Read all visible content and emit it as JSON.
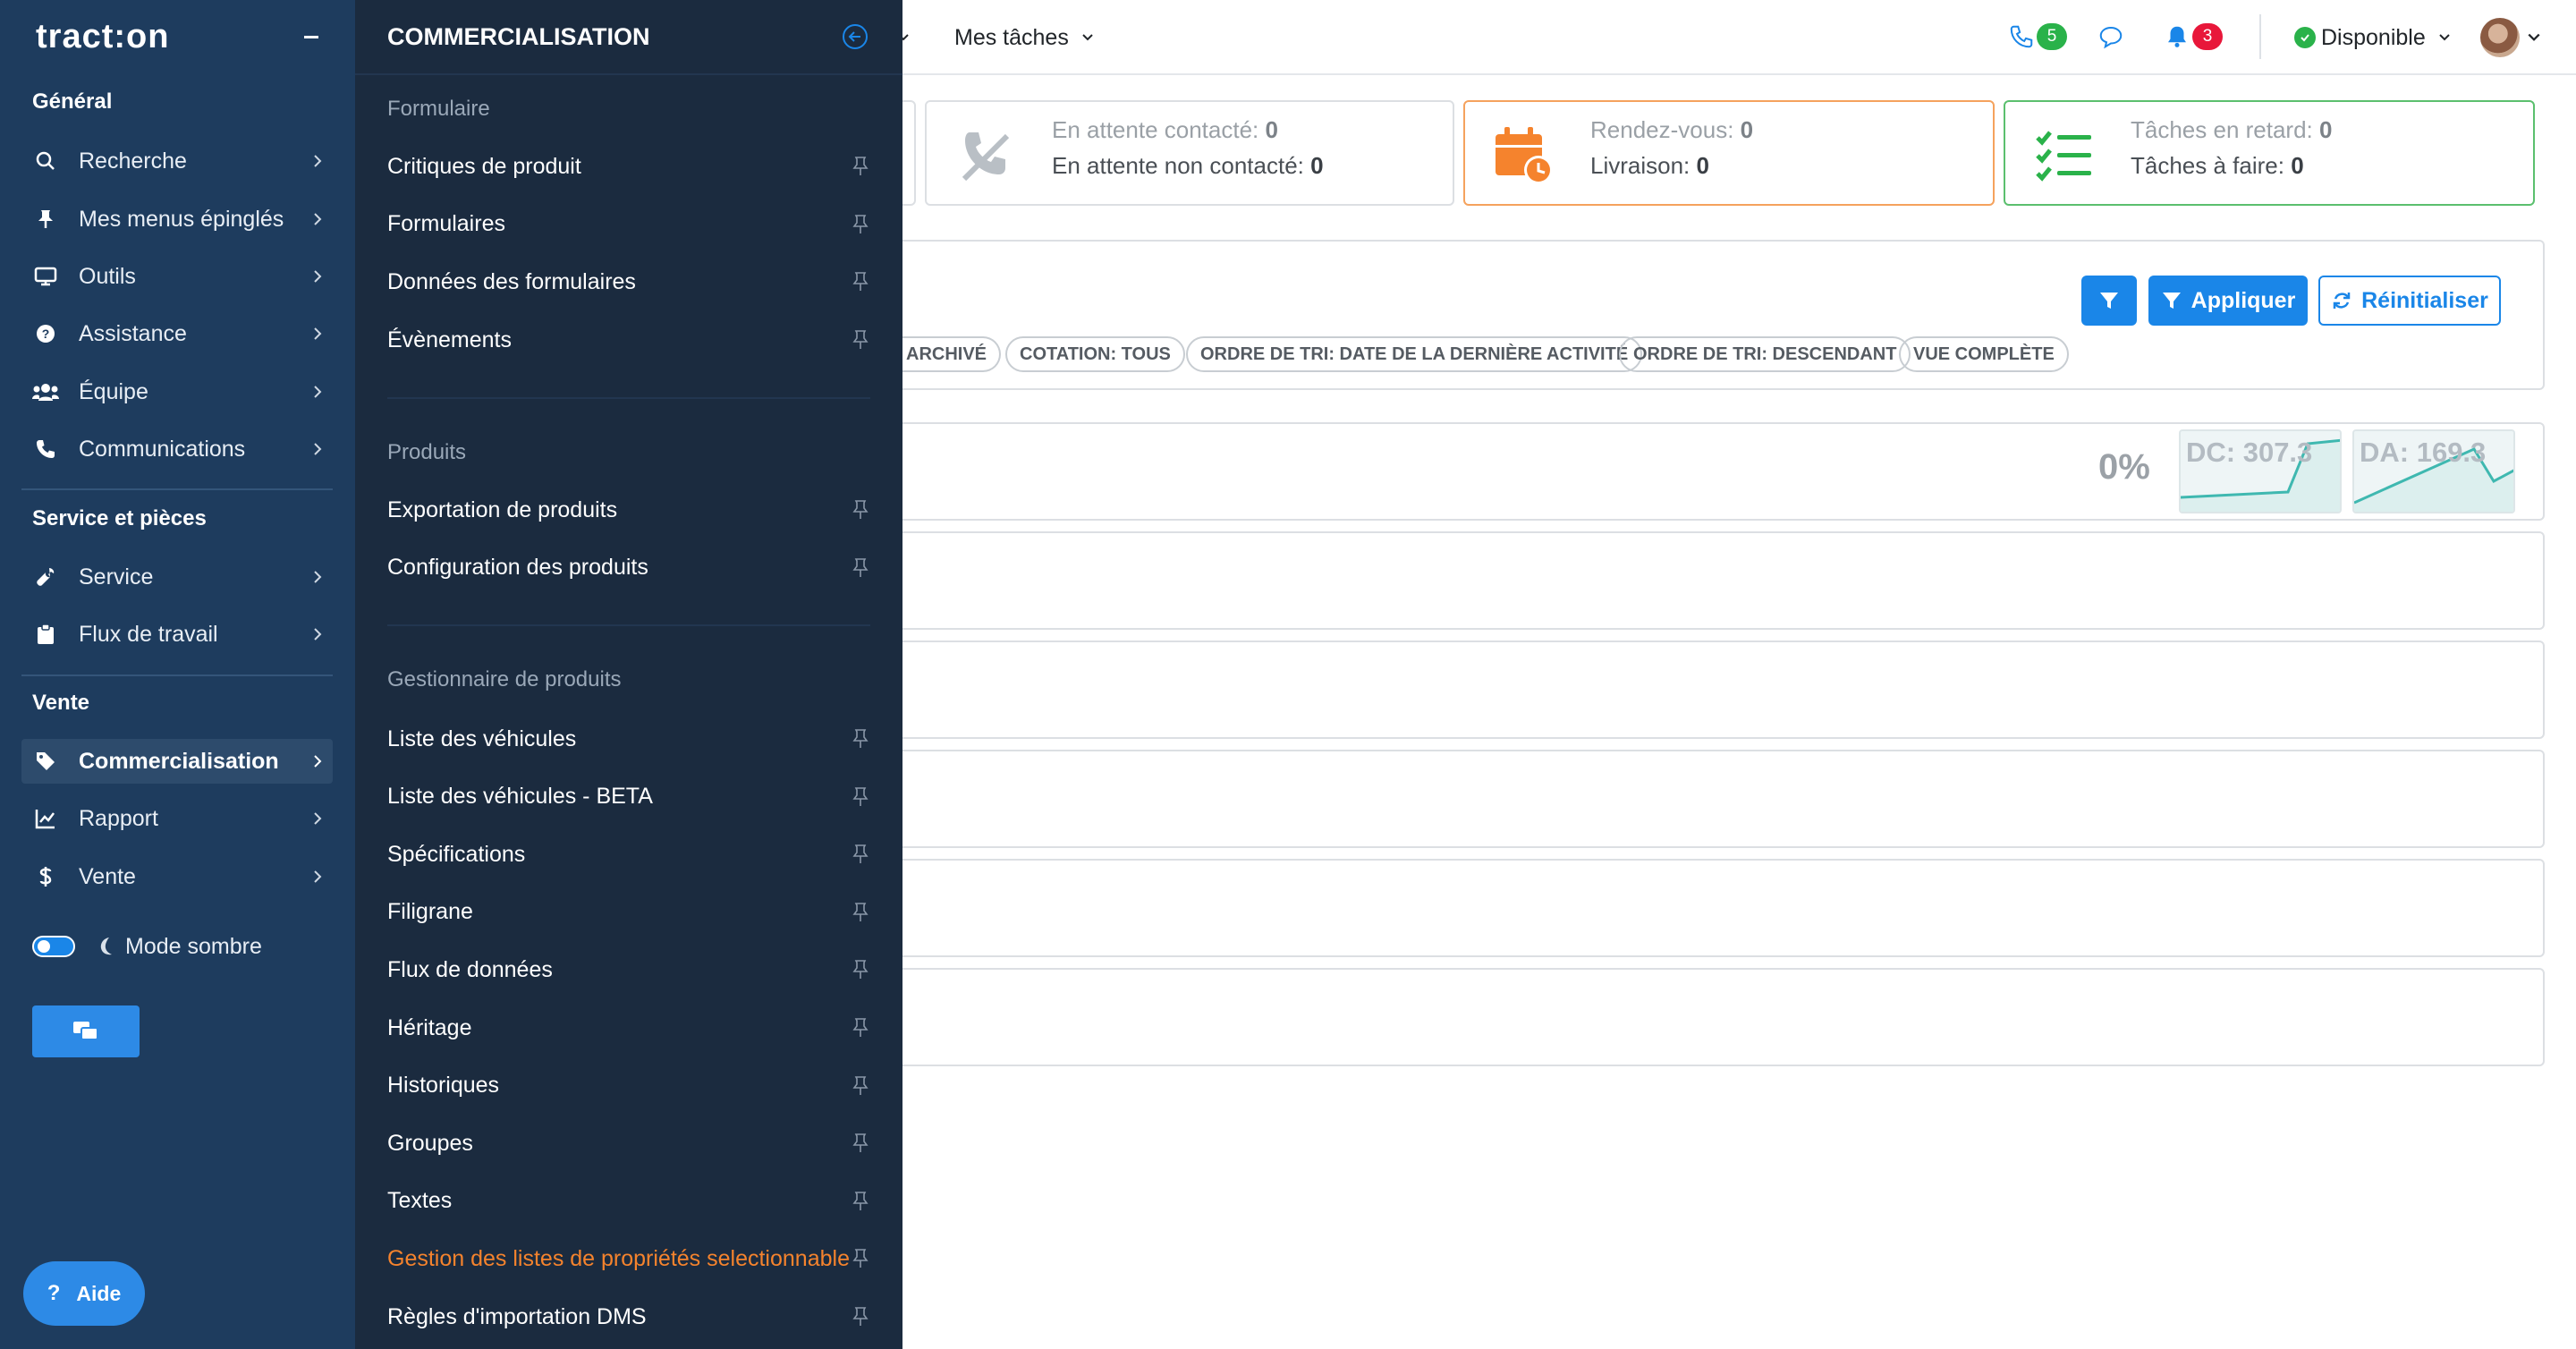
{
  "topbar": {
    "my_tasks_label": "Mes tâches",
    "phone_count": "5",
    "notifications_count": "3",
    "status_label": "Disponible"
  },
  "stats": {
    "contact": {
      "line1_label": "En attente contacté:",
      "line1_value": "0",
      "line2_label": "En attente non contacté:",
      "line2_value": "0"
    },
    "appointment": {
      "line1_label": "Rendez-vous:",
      "line1_value": "0",
      "line2_label": "Livraison:",
      "line2_value": "0"
    },
    "tasks": {
      "line1_label": "Tâches en retard:",
      "line1_value": "0",
      "line2_label": "Tâches à faire:",
      "line2_value": "0"
    }
  },
  "filters": {
    "apply_label": "Appliquer",
    "reset_label": "Réinitialiser",
    "chips": [
      "ARCHIVÉ",
      "COTATION: TOUS",
      "ORDRE DE TRI: DATE DE LA DERNIÈRE ACTIVITÉ",
      "ORDRE DE TRI: DESCENDANT",
      "VUE COMPLÈTE"
    ]
  },
  "summary": {
    "percent": "0%",
    "dc_label": "DC: 307.3",
    "da_label": "DA: 169.3"
  },
  "sidebar": {
    "logo": "tract:on",
    "sections": {
      "general": "Général",
      "service": "Service et pièces",
      "sale": "Vente"
    },
    "items": {
      "search": "Recherche",
      "pinned": "Mes menus épinglés",
      "tools": "Outils",
      "assistance": "Assistance",
      "team": "Équipe",
      "communications": "Communications",
      "service": "Service",
      "workflow": "Flux de travail",
      "commercialisation": "Commercialisation",
      "report": "Rapport",
      "sale": "Vente"
    },
    "dark_mode_label": "Mode sombre",
    "help_label": "Aide"
  },
  "subpanel": {
    "title": "COMMERCIALISATION",
    "groups": {
      "form": "Formulaire",
      "products": "Produits",
      "manager": "Gestionnaire de produits"
    },
    "form_items": [
      "Critiques de produit",
      "Formulaires",
      "Données des formulaires",
      "Évènements"
    ],
    "product_items": [
      "Exportation de produits",
      "Configuration des produits"
    ],
    "manager_items": [
      "Liste des véhicules",
      "Liste des véhicules - BETA",
      "Spécifications",
      "Filigrane",
      "Flux de données",
      "Héritage",
      "Historiques",
      "Groupes",
      "Textes",
      "Gestion des listes de propriétés selectionnable",
      "Règles d'importation DMS"
    ]
  },
  "colors": {
    "sidebar_bg": "#1e3c5e",
    "panel_bg": "#1b2b3f",
    "accent_blue": "#1a86e8",
    "accent_orange": "#f5832d",
    "success_green": "#2ab24a",
    "danger_red": "#e8173a"
  }
}
